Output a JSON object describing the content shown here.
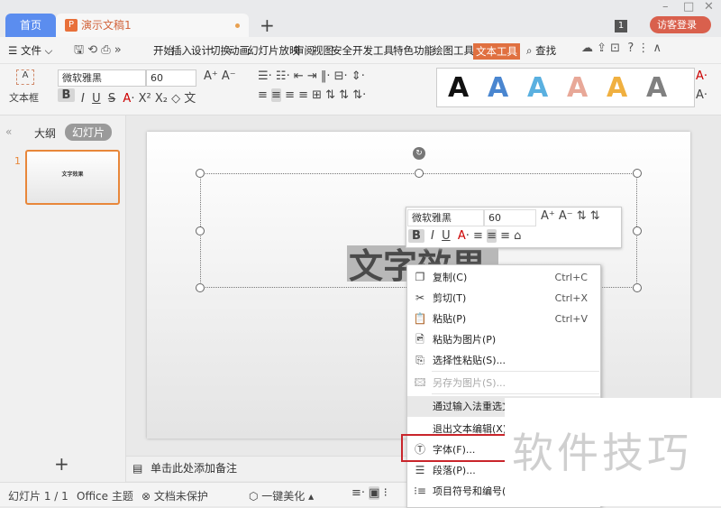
{
  "titlebar": {
    "home_tab": "首页",
    "doc_tab": "演示文稿1",
    "new_tab": "+",
    "badge": "1",
    "login": "访客登录",
    "min": "–",
    "max": "□",
    "close": "✕"
  },
  "menubar": {
    "file": "文件",
    "tabs": [
      "开始",
      "插入",
      "设计",
      "切换",
      "动画",
      "幻灯片放映",
      "审阅",
      "视图",
      "安全",
      "开发工具",
      "特色功能",
      "绘图工具",
      "文本工具"
    ],
    "active_tab": "文本工具",
    "search": "查找"
  },
  "ribbon": {
    "textbox_label": "文本框",
    "font_name": "微软雅黑",
    "font_size": "60",
    "style_sample": "A",
    "style_colors": [
      "#111111",
      "#4a86d0",
      "#5ab0e0",
      "#e8a898",
      "#f0b040",
      "#808080"
    ]
  },
  "left_pane": {
    "tab_outline": "大纲",
    "tab_slides": "幻灯片",
    "slide_number": "1",
    "thumb_text": "文字效果",
    "add": "+"
  },
  "slide": {
    "text": "文字效果"
  },
  "mini_toolbar": {
    "font_name": "微软雅黑",
    "font_size": "60"
  },
  "context_menu": {
    "items": [
      {
        "label": "复制(C)",
        "shortcut": "Ctrl+C",
        "icon": "copy-icon"
      },
      {
        "label": "剪切(T)",
        "shortcut": "Ctrl+X",
        "icon": "scissors-icon"
      },
      {
        "label": "粘贴(P)",
        "shortcut": "Ctrl+V",
        "icon": "paste-icon"
      },
      {
        "label": "粘贴为图片(P)",
        "shortcut": "",
        "icon": "paste-image-icon"
      },
      {
        "label": "选择性粘贴(S)...",
        "shortcut": "",
        "icon": "paste-special-icon"
      },
      {
        "label": "另存为图片(S)...",
        "shortcut": "",
        "icon": "save-image-icon",
        "disabled": true
      },
      {
        "label": "通过输入法重选文",
        "shortcut": "",
        "icon": ""
      },
      {
        "label": "退出文本编辑(X)",
        "shortcut": "",
        "icon": ""
      },
      {
        "label": "字体(F)...",
        "shortcut": "",
        "icon": "font-icon"
      },
      {
        "label": "段落(P)...",
        "shortcut": "",
        "icon": "paragraph-icon"
      },
      {
        "label": "项目符号和编号(B",
        "shortcut": "",
        "icon": "bullets-icon"
      }
    ]
  },
  "notes": {
    "placeholder": "单击此处添加备注"
  },
  "status": {
    "slide": "幻灯片 1 / 1",
    "theme": "Office 主题",
    "protect": "文档未保护",
    "beautify": "一键美化"
  },
  "watermark": "软件技巧",
  "colors": {
    "accent": "#e07040",
    "home_tab": "#5b8def",
    "highlight_box": "#c9252b"
  }
}
